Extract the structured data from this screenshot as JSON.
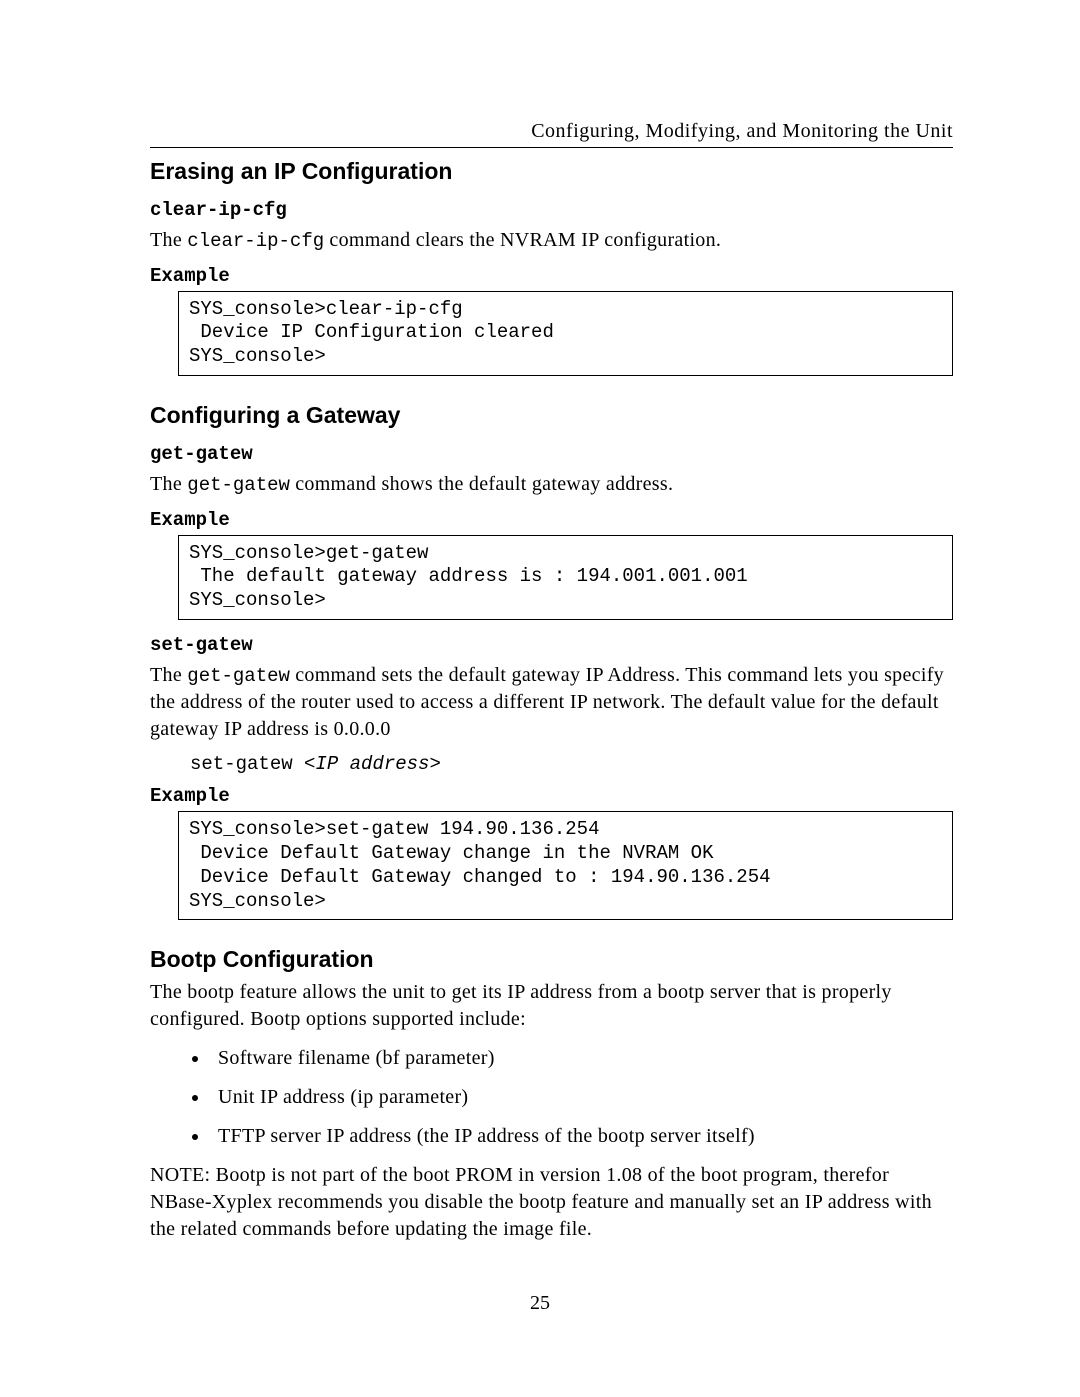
{
  "header": {
    "running_head": "Configuring, Modifying, and Monitoring the Unit"
  },
  "sections": {
    "s1": {
      "title": "Erasing an IP Configuration",
      "cmd1": {
        "name": "clear-ip-cfg",
        "desc_pre": "The ",
        "desc_mono": "clear-ip-cfg",
        "desc_post": " command clears the NVRAM IP configuration.",
        "example_label": "Example",
        "example": "SYS_console>clear-ip-cfg\n Device IP Configuration cleared\nSYS_console>"
      }
    },
    "s2": {
      "title": "Configuring a Gateway",
      "cmd1": {
        "name": "get-gatew",
        "desc_pre": "The ",
        "desc_mono": "get-gatew",
        "desc_post": " command shows the default gateway address.",
        "example_label": "Example",
        "example": "SYS_console>get-gatew\n The default gateway address is : 194.001.001.001\nSYS_console>"
      },
      "cmd2": {
        "name": "set-gatew",
        "desc_pre": "The ",
        "desc_mono": "get-gatew",
        "desc_post": " command sets the default gateway IP Address. This command lets you specify the address of the router used to access a different IP network. The default value for the default gateway IP address is 0.0.0.0",
        "syntax_pre": "set-gatew ",
        "syntax_ital": "<IP address>",
        "example_label": "Example",
        "example": "SYS_console>set-gatew 194.90.136.254\n Device Default Gateway change in the NVRAM OK\n Device Default Gateway changed to : 194.90.136.254\nSYS_console>"
      }
    },
    "s3": {
      "title": "Bootp Configuration",
      "intro": "The bootp feature allows the unit to get its IP address from a bootp server that is properly configured.  Bootp options supported include:",
      "bullets": [
        "Software filename (bf parameter)",
        "Unit IP address (ip parameter)",
        "TFTP server IP address (the IP address of the bootp server itself)"
      ],
      "note": "NOTE:  Bootp is not part of the boot PROM in version 1.08 of the boot program, therefor NBase-Xyplex recommends you disable the bootp feature and manually set an IP address with the related commands before updating the image file."
    }
  },
  "page_number": "25"
}
